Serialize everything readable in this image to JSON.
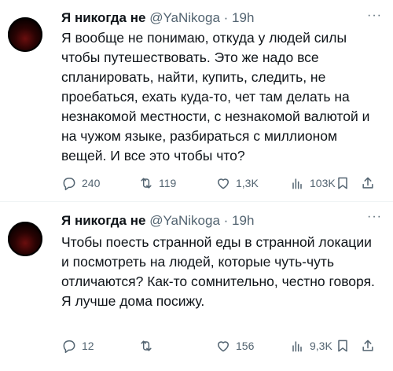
{
  "tweets": [
    {
      "name": "Я никогда не",
      "handle": "@YaNikoga",
      "time": "· 19h",
      "more": "···",
      "text": "Я вообще не понимаю, откуда у людей силы чтобы путешествовать. Это же надо все спланировать, найти, купить, следить, не проебаться, ехать куда-то, чет там делать на незнакомой местности, с незнакомой валютой и на чужом языке, разбираться с миллионом вещей. И все это чтобы что?",
      "replies": "240",
      "retweets": "119",
      "likes": "1,3K",
      "views": "103K"
    },
    {
      "name": "Я никогда не",
      "handle": "@YaNikoga",
      "time": "· 19h",
      "more": "···",
      "text": "Чтобы поесть странной еды в странной локации и посмотреть на людей, которые чуть-чуть отличаются? Как-то сомнительно, честно говоря. Я лучше дома посижу.",
      "replies": "12",
      "retweets": "",
      "likes": "156",
      "views": "9,3K"
    }
  ],
  "icons": {
    "reply": "reply-icon",
    "retweet": "retweet-icon",
    "like": "heart-icon",
    "views": "views-icon",
    "bookmark": "bookmark-icon",
    "share": "share-icon"
  },
  "colors": {
    "text": "#0f1419",
    "secondary": "#536471",
    "divider": "#eff3f4"
  }
}
